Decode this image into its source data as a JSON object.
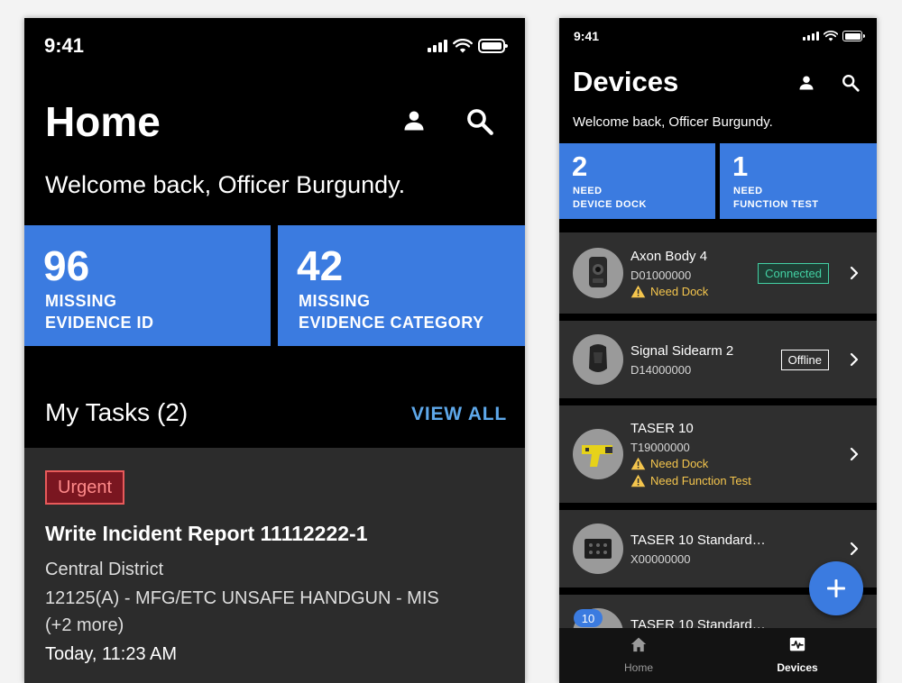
{
  "home_screen": {
    "status_time": "9:41",
    "title": "Home",
    "welcome": "Welcome back, Officer Burgundy.",
    "tiles": [
      {
        "number": "96",
        "line1": "MISSING",
        "line2": "EVIDENCE ID"
      },
      {
        "number": "42",
        "line1": "MISSING",
        "line2": "EVIDENCE CATEGORY"
      }
    ],
    "tasks_title": "My Tasks (2)",
    "view_all": "VIEW ALL",
    "task": {
      "badge": "Urgent",
      "title": "Write Incident Report 11112222-1",
      "district": "Central District",
      "offense": "12125(A) - MFG/ETC UNSAFE HANDGUN - MIS",
      "more": "(+2 more)",
      "time": "Today, 11:23 AM"
    }
  },
  "devices_screen": {
    "status_time": "9:41",
    "title": "Devices",
    "welcome": "Welcome back, Officer Burgundy.",
    "tiles": [
      {
        "number": "2",
        "line1": "NEED",
        "line2": "DEVICE DOCK"
      },
      {
        "number": "1",
        "line1": "NEED",
        "line2": "FUNCTION TEST"
      }
    ],
    "devices": [
      {
        "name": "Axon Body 4",
        "serial": "D01000000",
        "status": "Connected",
        "warnings": [
          "Need Dock"
        ]
      },
      {
        "name": "Signal Sidearm 2",
        "serial": "D14000000",
        "status": "Offline",
        "warnings": []
      },
      {
        "name": "TASER 10",
        "serial": "T19000000",
        "status": "",
        "warnings": [
          "Need Dock",
          "Need Function Test"
        ]
      },
      {
        "name": "TASER 10 Standard…",
        "serial": "X00000000",
        "status": "",
        "warnings": []
      },
      {
        "name": "TASER 10 Standard…",
        "serial": "",
        "status": "",
        "warnings": []
      }
    ],
    "count_badge": "10",
    "nav": {
      "home": "Home",
      "devices": "Devices"
    },
    "colors": {
      "accent": "#3b7be0",
      "connected": "#43d1a4",
      "warning": "#f4c54d"
    }
  }
}
